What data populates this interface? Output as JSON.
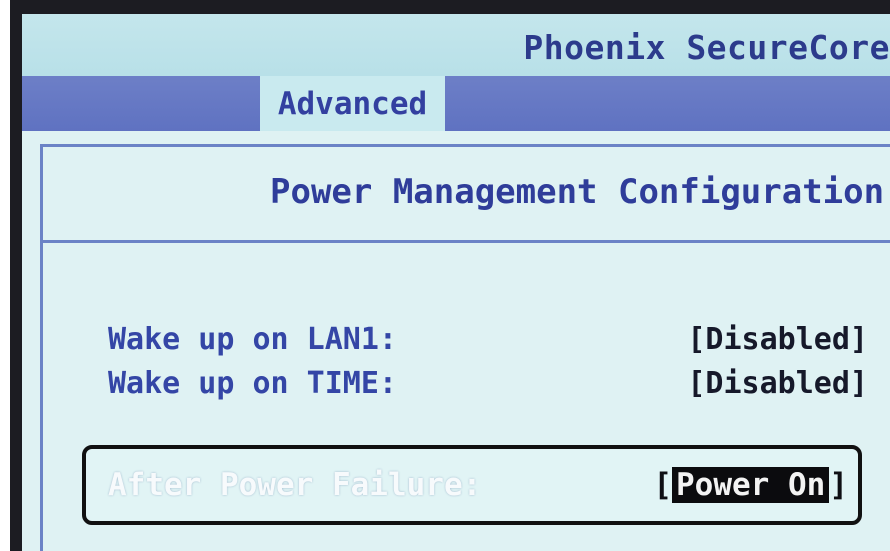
{
  "header": {
    "bios_title": "Phoenix SecureCore"
  },
  "tabs": [
    {
      "label": "Advanced",
      "active": true
    }
  ],
  "panel": {
    "title": "Power Management Configuration"
  },
  "settings": [
    {
      "label": "Wake up on LAN1:",
      "value": "[Disabled]"
    },
    {
      "label": "Wake up on TIME:",
      "value": "[Disabled]"
    }
  ],
  "selected_setting": {
    "label": "After Power Failure:",
    "bracket_open": "[",
    "value": "Power On",
    "bracket_close": "]"
  },
  "colors": {
    "screen_bg": "#dff2f3",
    "tab_bar": "#5f72c1",
    "text_blue": "#3446a6",
    "value_dark": "#16192a",
    "highlight_bg": "#0b0b0e"
  }
}
